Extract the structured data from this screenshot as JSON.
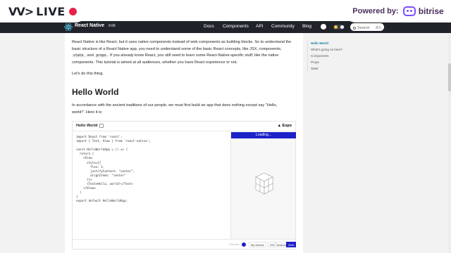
{
  "overlay": {
    "live_logo": "VV>",
    "live_label": "LIVE",
    "powered_by": "Powered by:",
    "sponsor": "bitrise"
  },
  "nav": {
    "title": "React Native",
    "version": "0.66",
    "links": [
      "Docs",
      "Components",
      "API",
      "Community",
      "Blog"
    ],
    "search_placeholder": "Search",
    "search_shortcut": "⌘K"
  },
  "toc": [
    {
      "label": "Hello World",
      "active": true
    },
    {
      "label": "What's going on here?",
      "active": false
    },
    {
      "label": "Components",
      "active": false
    },
    {
      "label": "Props",
      "active": false
    },
    {
      "label": "State",
      "active": false
    }
  ],
  "intro": {
    "line1": "React Native is like React, but it uses native components instead of web components as building blocks. So to understand the",
    "line2": "basic structure of a React Native app, you need to understand some of the basic React concepts, like JSX, components,",
    "code_state": "state",
    "and": ", and",
    "code_props": "props",
    "line3_rest": ". If you already know React, you still need to learn some React-Native-specific stuff, like the native",
    "line4": "components. This tutorial is aimed at all audiences, whether you have React experience or not.",
    "lets_do": "Let's do this thing."
  },
  "heading": "Hello World",
  "hello_para": {
    "line1": "In accordance with the ancient traditions of our people, we must first build an app that does nothing except say \"Hello,",
    "line2": "world!\". Here it is:"
  },
  "snack": {
    "name": "Hello World",
    "expo_label": "Expo",
    "loading": "Loading...",
    "code": [
      "import React from 'react';",
      "import { Text, View } from 'react-native';",
      "",
      "const HelloWorldApp = () => {",
      "  return (",
      "    <View",
      "      style={{",
      "        flex: 1,",
      "        justifyContent: \"center\",",
      "        alignItems: \"center\"",
      "      }}>",
      "      <Text>Hello, world!</Text>",
      "    </View>",
      "  )",
      "}",
      "export default HelloWorldApp;"
    ],
    "footer_preview": "Preview",
    "platforms": [
      "My Device",
      "iOS",
      "Android",
      "Web"
    ],
    "active_platform": "Web"
  },
  "colors": {
    "nav_bg": "#20232a",
    "accent": "#61dafb",
    "snack_blue": "#1c22c7",
    "live_red": "#e8234b",
    "toc_active": "#0b7e9a"
  }
}
